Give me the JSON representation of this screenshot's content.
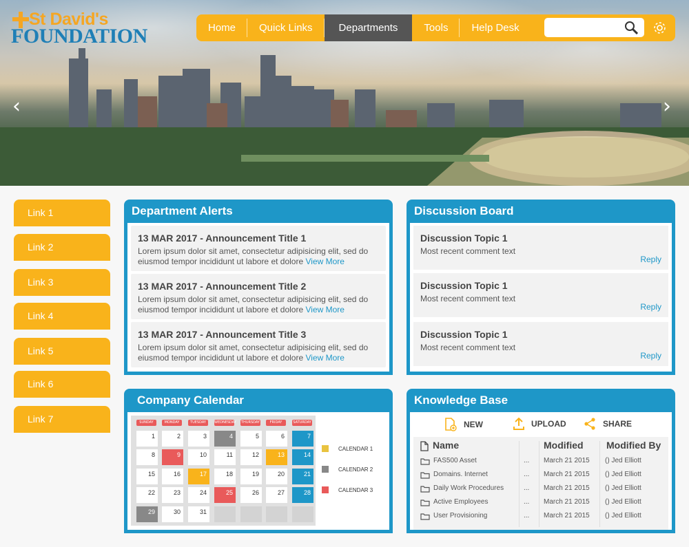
{
  "logo": {
    "line1": "St David's",
    "line2": "FOUNDATION"
  },
  "nav": {
    "items": [
      {
        "label": "Home"
      },
      {
        "label": "Quick Links"
      },
      {
        "label": "Departments"
      },
      {
        "label": "Tools"
      },
      {
        "label": "Help Desk"
      }
    ],
    "active": "Departments",
    "search_placeholder": ""
  },
  "hero": {
    "prev": "‹",
    "next": "›"
  },
  "sidebar": {
    "links": [
      {
        "label": "Link 1"
      },
      {
        "label": "Link 2"
      },
      {
        "label": "Link 3"
      },
      {
        "label": "Link 4"
      },
      {
        "label": "Link 5"
      },
      {
        "label": "Link 6"
      },
      {
        "label": "Link 7"
      }
    ]
  },
  "alerts": {
    "title": "Department Alerts",
    "items": [
      {
        "heading": "13 MAR 2017 - Announcement Title 1",
        "body": "Lorem ipsum dolor sit amet, consectetur adipisicing elit, sed do eiusmod tempor incididunt ut labore et dolore ",
        "link": "View More"
      },
      {
        "heading": "13 MAR 2017 - Announcement Title 2",
        "body": "Lorem ipsum dolor sit amet, consectetur adipisicing elit, sed do eiusmod tempor incididunt ut labore et dolore ",
        "link": "View More"
      },
      {
        "heading": "13 MAR 2017 - Announcement Title 3",
        "body": "Lorem ipsum dolor sit amet, consectetur adipisicing elit, sed do eiusmod tempor incididunt ut labore et dolore ",
        "link": "View More"
      }
    ]
  },
  "discussion": {
    "title": "Discussion Board",
    "items": [
      {
        "topic": "Discussion Topic 1",
        "comment": "Most recent comment text",
        "reply": "Reply"
      },
      {
        "topic": "Discussion Topic 1",
        "comment": "Most recent comment text",
        "reply": "Reply"
      },
      {
        "topic": "Discussion Topic 1",
        "comment": "Most recent comment text",
        "reply": "Reply"
      }
    ]
  },
  "calendar": {
    "title": "Company Calendar",
    "days": [
      "SUNDAY",
      "MONDAY",
      "TUESDAY",
      "WEDNESDAY",
      "THURSDAY",
      "FRIDAY",
      "SATURDAY"
    ],
    "dates": [
      [
        "",
        "1",
        "2",
        "3",
        "4",
        "5",
        "6",
        "7"
      ],
      [
        "8",
        "9",
        "10",
        "11",
        "12",
        "13",
        "14"
      ],
      [
        "15",
        "16",
        "17",
        "18",
        "19",
        "20",
        "21"
      ],
      [
        "22",
        "23",
        "24",
        "25",
        "26",
        "27",
        "28"
      ],
      [
        "29",
        "30",
        "31"
      ]
    ],
    "legend": [
      {
        "label": "CALENDAR 1",
        "color": "#e9c340"
      },
      {
        "label": "CALENDAR 2",
        "color": "#888888"
      },
      {
        "label": "CALENDAR 3",
        "color": "#e95a5a"
      }
    ],
    "colors": {
      "yellow": "#f9b31b",
      "gray": "#888888",
      "red": "#e95a5a",
      "blue": "#1e97c8"
    }
  },
  "kb": {
    "title": "Knowledge Base",
    "actions": [
      {
        "label": "NEW"
      },
      {
        "label": "UPLOAD"
      },
      {
        "label": "SHARE"
      }
    ],
    "columns": [
      "Name",
      "Modified",
      "Modified By"
    ],
    "rows": [
      {
        "name": "FAS500 Asset",
        "dots": "...",
        "modified": "March 21 2015",
        "by": "() Jed Elliott"
      },
      {
        "name": "Domains. Internet",
        "dots": "...",
        "modified": "March 21 2015",
        "by": "() Jed Elliott"
      },
      {
        "name": "Daily Work Procedures",
        "dots": "...",
        "modified": "March 21 2015",
        "by": "() Jed Elliott"
      },
      {
        "name": "Active Employees",
        "dots": "...",
        "modified": "March 21 2015",
        "by": "() Jed Elliott"
      },
      {
        "name": "User Provisioning",
        "dots": "...",
        "modified": "March 21 2015",
        "by": "() Jed Elliott"
      }
    ]
  },
  "theme": {
    "accent": "#f9b31b",
    "panel": "#1e97c8",
    "nav_active": "#555555"
  }
}
